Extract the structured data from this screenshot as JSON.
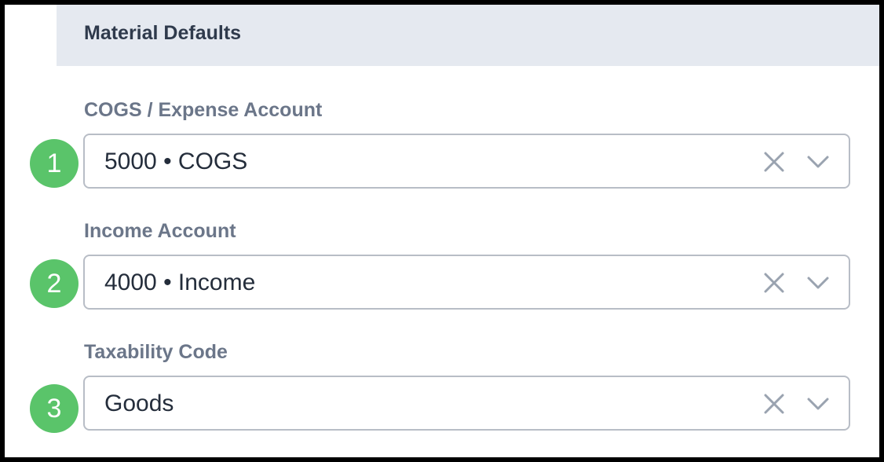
{
  "section": {
    "title": "Material Defaults"
  },
  "fields": [
    {
      "step": "1",
      "label": "COGS / Expense Account",
      "value": "5000 • COGS"
    },
    {
      "step": "2",
      "label": "Income Account",
      "value": "4000 • Income"
    },
    {
      "step": "3",
      "label": "Taxability Code",
      "value": "Goods"
    }
  ],
  "icons": {
    "clear": "close-icon",
    "dropdown": "chevron-down-icon"
  },
  "colors": {
    "header_bg": "#e5e9f0",
    "badge": "#5ac46a",
    "label": "#6b7689",
    "value": "#242d3b",
    "border": "#b8bdc6",
    "icon": "#9aa3b0"
  }
}
